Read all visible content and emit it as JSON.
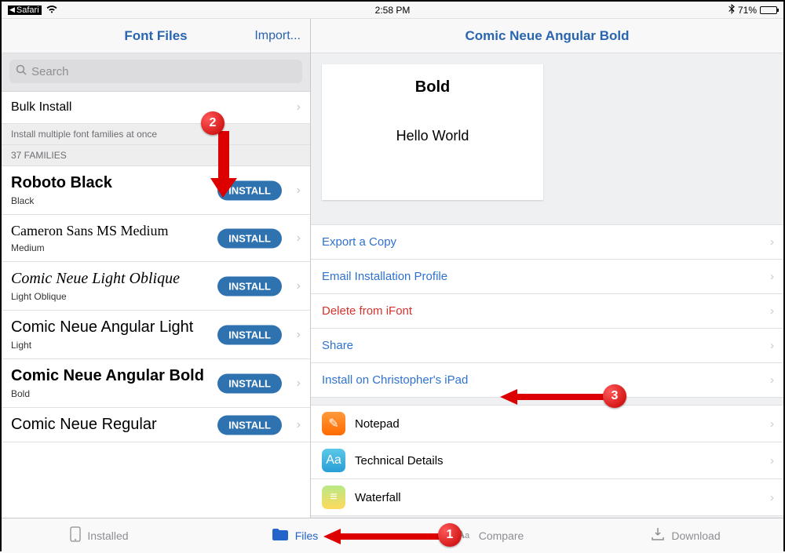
{
  "statusbar": {
    "back_app": "Safari",
    "time": "2:58 PM",
    "battery_pct": "71%"
  },
  "left": {
    "title": "Font Files",
    "import": "Import...",
    "search_placeholder": "Search",
    "bulk_label": "Bulk Install",
    "bulk_sub": "Install multiple font families at once",
    "family_count": "37 FAMILIES",
    "install_btn": "INSTALL",
    "fonts": [
      {
        "name": "Roboto Black",
        "sub": "Black",
        "cls": "fn-roboto"
      },
      {
        "name": "Cameron Sans MS Medium",
        "sub": "Medium",
        "cls": "fn-cameron"
      },
      {
        "name": "Comic Neue Light Oblique",
        "sub": "Light Oblique",
        "cls": "fn-cn-light-ob"
      },
      {
        "name": "Comic Neue Angular Light",
        "sub": "Light",
        "cls": "fn-cn-ang-light"
      },
      {
        "name": "Comic Neue Angular Bold",
        "sub": "Bold",
        "cls": "fn-cn-ang-bold"
      },
      {
        "name": "Comic Neue Regular",
        "sub": "",
        "cls": "fn-cn-reg"
      }
    ]
  },
  "right": {
    "title": "Comic Neue Angular Bold",
    "preview_style": "Bold",
    "preview_text": "Hello World",
    "actions": {
      "export": "Export a Copy",
      "email": "Email Installation Profile",
      "delete": "Delete from iFont",
      "share": "Share",
      "install_device": "Install on Christopher's iPad"
    },
    "apps": [
      {
        "label": "Notepad",
        "icon": "ic-notepad",
        "glyph": "✎"
      },
      {
        "label": "Technical Details",
        "icon": "ic-tech",
        "glyph": "Aa"
      },
      {
        "label": "Waterfall",
        "icon": "ic-waterfall",
        "glyph": "≡"
      }
    ]
  },
  "tabs": {
    "installed": "Installed",
    "files": "Files",
    "compare": "Compare",
    "download": "Download"
  },
  "markers": {
    "1": "1",
    "2": "2",
    "3": "3"
  }
}
